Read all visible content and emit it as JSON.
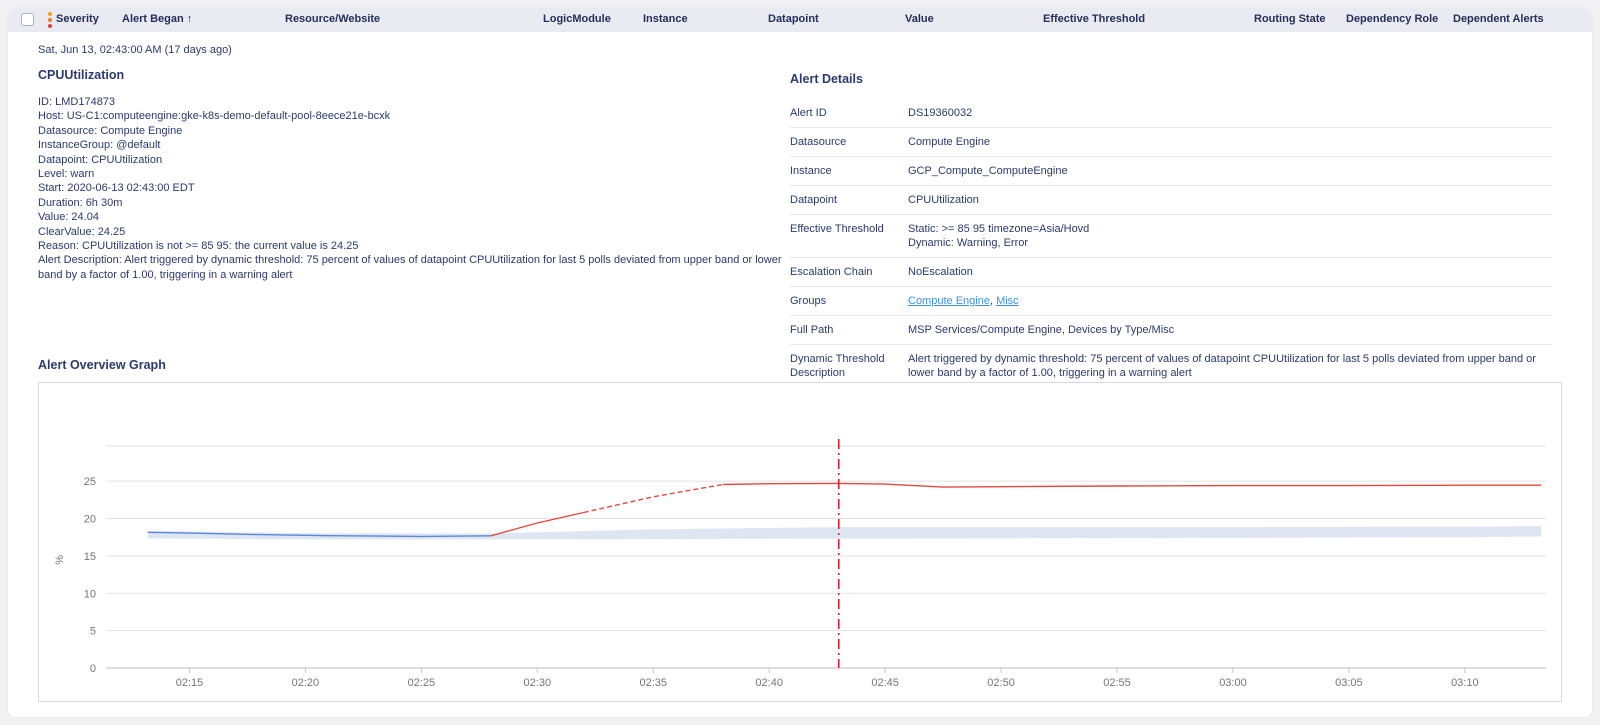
{
  "colors": {
    "text_navy": "#2c3a6b",
    "link_blue": "#4090e4",
    "header_bg": "#e9eaf2"
  },
  "table_header": {
    "severity_dot_colors": [
      "#f3a21b",
      "#ef7b30",
      "#e2403a"
    ],
    "columns": [
      {
        "label": "Severity"
      },
      {
        "label": "Alert Began",
        "sort_arrow": "↑"
      },
      {
        "label": "Resource/Website"
      },
      {
        "label": "LogicModule"
      },
      {
        "label": "Instance"
      },
      {
        "label": "Datapoint"
      },
      {
        "label": "Value"
      },
      {
        "label": "Effective Threshold"
      },
      {
        "label": "Routing State"
      },
      {
        "label": "Dependency Role"
      },
      {
        "label": "Dependent Alerts"
      }
    ]
  },
  "alert": {
    "began": "Sat, Jun 13, 02:43:00 AM (17 days ago)",
    "title": "CPUUtilization",
    "summary": [
      {
        "label": "ID",
        "value": "LMD174873"
      },
      {
        "label": "Host",
        "value": "US-C1:computeengine:gke-k8s-demo-default-pool-8eece21e-bcxk"
      },
      {
        "label": "Datasource",
        "value": "Compute Engine"
      },
      {
        "label": "InstanceGroup",
        "value": "@default"
      },
      {
        "label": "Datapoint",
        "value": "CPUUtilization"
      },
      {
        "label": "Level",
        "value": "warn"
      },
      {
        "label": "Start",
        "value": "2020-06-13 02:43:00 EDT"
      },
      {
        "label": "Duration",
        "value": "6h 30m"
      },
      {
        "label": "Value",
        "value": "24.04"
      },
      {
        "label": "ClearValue",
        "value": "24.25"
      },
      {
        "label": "Reason",
        "value": "CPUUtilization is not >= 85 95: the current value is 24.25"
      },
      {
        "label": "Alert Description",
        "value": "Alert triggered by dynamic threshold: 75 percent of values of datapoint CPUUtilization for last 5 polls deviated from upper band or lower band by a factor of 1.00, triggering in a warning alert"
      }
    ]
  },
  "alert_details": {
    "title": "Alert Details",
    "rows": [
      {
        "label": "Alert ID",
        "value": "DS19360032"
      },
      {
        "label": "Datasource",
        "value": "Compute Engine"
      },
      {
        "label": "Instance",
        "value": "GCP_Compute_ComputeEngine"
      },
      {
        "label": "Datapoint",
        "value": "CPUUtilization"
      },
      {
        "label": "Effective Threshold",
        "lines": [
          "Static: >= 85 95 timezone=Asia/Hovd",
          "Dynamic: Warning, Error"
        ]
      },
      {
        "label": "Escalation Chain",
        "value": "NoEscalation"
      },
      {
        "label": "Groups",
        "links": [
          "Compute Engine",
          "Misc"
        ]
      },
      {
        "label": "Full Path",
        "value": "MSP Services/Compute Engine, Devices by Type/Misc"
      },
      {
        "label": "Dynamic Threshold Description",
        "value": "Alert triggered by dynamic threshold: 75 percent of values of datapoint CPUUtilization for last 5 polls deviated from upper band or lower band by a factor of 1.00, triggering in a warning alert"
      }
    ]
  },
  "graph_section": {
    "title": "Alert Overview Graph"
  },
  "chart_data": {
    "type": "line",
    "title": "Alert Overview Graph",
    "ylabel": "%",
    "yticks": [
      0,
      5,
      10,
      15,
      20,
      25
    ],
    "ylim": [
      0,
      29.7
    ],
    "xlim_minutes": [
      131.4,
      193.5
    ],
    "grid": true,
    "xticks": [
      {
        "minute": 135,
        "label": "02:15"
      },
      {
        "minute": 140,
        "label": "02:20"
      },
      {
        "minute": 145,
        "label": "02:25"
      },
      {
        "minute": 150,
        "label": "02:30"
      },
      {
        "minute": 155,
        "label": "02:35"
      },
      {
        "minute": 160,
        "label": "02:40"
      },
      {
        "minute": 165,
        "label": "02:45"
      },
      {
        "minute": 170,
        "label": "02:50"
      },
      {
        "minute": 175,
        "label": "02:55"
      },
      {
        "minute": 180,
        "label": "03:00"
      },
      {
        "minute": 185,
        "label": "03:05"
      },
      {
        "minute": 190,
        "label": "03:10"
      }
    ],
    "alert_time": {
      "minute": 163,
      "label": "02:43",
      "line_color": "#e01f1f"
    },
    "band": {
      "name": "dynamic-threshold-band",
      "color": "#d9e2f1",
      "x": [
        133.2,
        140,
        148,
        155,
        163,
        170,
        180,
        190,
        193.3
      ],
      "top": [
        18.35,
        18.05,
        18.0,
        18.55,
        18.85,
        18.85,
        18.85,
        18.9,
        19.0
      ],
      "bottom": [
        17.35,
        17.2,
        17.2,
        17.25,
        17.3,
        17.35,
        17.4,
        17.5,
        17.6
      ]
    },
    "series": [
      {
        "name": "CPUUtilization before alert",
        "color": "#5b87d8",
        "style": "solid",
        "points": [
          [
            133.2,
            18.15
          ],
          [
            135,
            18.05
          ],
          [
            138,
            17.85
          ],
          [
            141,
            17.7
          ],
          [
            145,
            17.6
          ],
          [
            148,
            17.68
          ]
        ]
      },
      {
        "name": "CPUUtilization rising",
        "color": "#e2493f",
        "style": "solid",
        "points": [
          [
            148,
            17.68
          ],
          [
            150,
            19.4
          ],
          [
            152,
            20.8
          ]
        ]
      },
      {
        "name": "CPUUtilization rising detected",
        "color": "#e2493f",
        "style": "dashed",
        "points": [
          [
            152,
            20.8
          ],
          [
            155,
            22.9
          ],
          [
            158,
            24.55
          ]
        ]
      },
      {
        "name": "CPUUtilization in alert",
        "color": "#e2493f",
        "style": "solid",
        "points": [
          [
            158,
            24.55
          ],
          [
            160,
            24.65
          ],
          [
            163,
            24.7
          ],
          [
            165,
            24.6
          ],
          [
            167.5,
            24.2
          ],
          [
            170,
            24.25
          ],
          [
            175,
            24.35
          ],
          [
            180,
            24.4
          ],
          [
            185,
            24.4
          ],
          [
            190,
            24.45
          ],
          [
            193.3,
            24.45
          ]
        ]
      }
    ]
  }
}
